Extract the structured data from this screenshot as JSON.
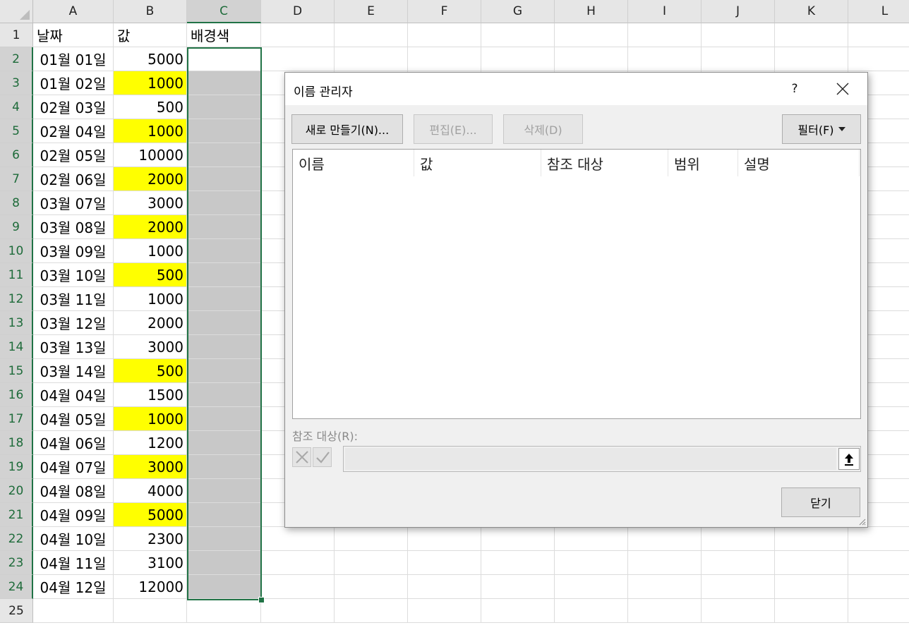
{
  "spreadsheet": {
    "columns": [
      "A",
      "B",
      "C",
      "D",
      "E",
      "F",
      "G",
      "H",
      "I",
      "J",
      "K",
      "L"
    ],
    "header_row": {
      "a": "날짜",
      "b": "값",
      "c": "배경색"
    },
    "rows": [
      {
        "row": "2",
        "date": "01월 01일",
        "value": "5000",
        "highlight": false
      },
      {
        "row": "3",
        "date": "01월 02일",
        "value": "1000",
        "highlight": true
      },
      {
        "row": "4",
        "date": "02월 03일",
        "value": "500",
        "highlight": false
      },
      {
        "row": "5",
        "date": "02월 04일",
        "value": "1000",
        "highlight": true
      },
      {
        "row": "6",
        "date": "02월 05일",
        "value": "10000",
        "highlight": false
      },
      {
        "row": "7",
        "date": "02월 06일",
        "value": "2000",
        "highlight": true
      },
      {
        "row": "8",
        "date": "03월 07일",
        "value": "3000",
        "highlight": false
      },
      {
        "row": "9",
        "date": "03월 08일",
        "value": "2000",
        "highlight": true
      },
      {
        "row": "10",
        "date": "03월 09일",
        "value": "1000",
        "highlight": false
      },
      {
        "row": "11",
        "date": "03월 10일",
        "value": "500",
        "highlight": true
      },
      {
        "row": "12",
        "date": "03월 11일",
        "value": "1000",
        "highlight": false
      },
      {
        "row": "13",
        "date": "03월 12일",
        "value": "2000",
        "highlight": false
      },
      {
        "row": "14",
        "date": "03월 13일",
        "value": "3000",
        "highlight": false
      },
      {
        "row": "15",
        "date": "03월 14일",
        "value": "500",
        "highlight": true
      },
      {
        "row": "16",
        "date": "04월 04일",
        "value": "1500",
        "highlight": false
      },
      {
        "row": "17",
        "date": "04월 05일",
        "value": "1000",
        "highlight": true
      },
      {
        "row": "18",
        "date": "04월 06일",
        "value": "1200",
        "highlight": false
      },
      {
        "row": "19",
        "date": "04월 07일",
        "value": "3000",
        "highlight": true
      },
      {
        "row": "20",
        "date": "04월 08일",
        "value": "4000",
        "highlight": false
      },
      {
        "row": "21",
        "date": "04월 09일",
        "value": "5000",
        "highlight": true
      },
      {
        "row": "22",
        "date": "04월 10일",
        "value": "2300",
        "highlight": false
      },
      {
        "row": "23",
        "date": "04월 11일",
        "value": "3100",
        "highlight": false
      },
      {
        "row": "24",
        "date": "04월 12일",
        "value": "12000",
        "highlight": false
      }
    ],
    "row_numbers_extra": [
      "1",
      "25"
    ],
    "selected_column": "C",
    "selected_range": "C2:C24",
    "colors": {
      "highlight": "#ffff00",
      "fill_grey": "#c8c8c8",
      "selection": "#217346"
    }
  },
  "dialog": {
    "title": "이름 관리자",
    "help_label": "?",
    "buttons": {
      "new": "새로 만들기(N)...",
      "edit": "편집(E)...",
      "delete": "삭제(D)",
      "filter": "필터(F)",
      "close": "닫기"
    },
    "list_columns": [
      "이름",
      "값",
      "참조 대상",
      "범위",
      "설명"
    ],
    "refers_to_label": "참조 대상(R):",
    "refers_to_value": "",
    "icons": {
      "cancel": "x-icon",
      "confirm": "check-icon",
      "collapse": "collapse-dialog-icon",
      "close": "close-icon"
    }
  }
}
